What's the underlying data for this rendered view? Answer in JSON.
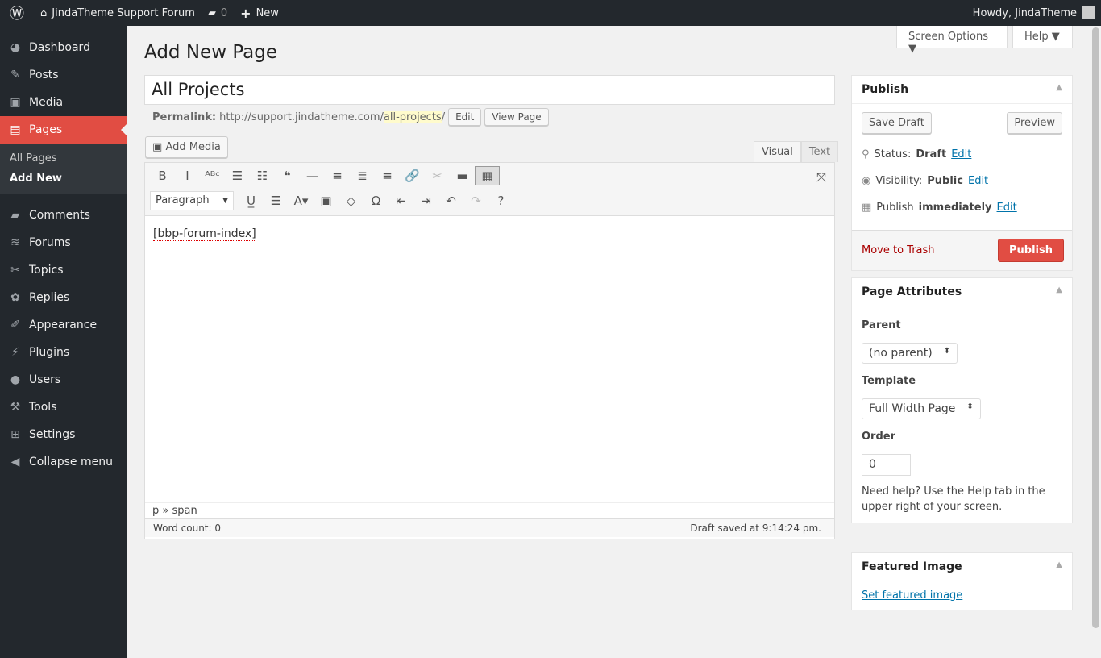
{
  "adminbar": {
    "site": "JindaTheme Support Forum",
    "comments": "0",
    "new": "New",
    "howdy": "Howdy, JindaTheme"
  },
  "menu": [
    {
      "label": "Dashboard",
      "icon": "dashboard-icon",
      "g": "◕"
    },
    {
      "label": "Posts",
      "icon": "pin-icon",
      "g": "✎"
    },
    {
      "label": "Media",
      "icon": "media-icon",
      "g": "▣"
    },
    {
      "label": "Pages",
      "icon": "pages-icon",
      "g": "▤"
    }
  ],
  "submenu": [
    "All Pages",
    "Add New"
  ],
  "menu2": [
    {
      "label": "Comments",
      "icon": "comment-icon",
      "g": "▰"
    },
    {
      "label": "Forums",
      "icon": "forums-icon",
      "g": "≋"
    },
    {
      "label": "Topics",
      "icon": "topics-icon",
      "g": "✂"
    },
    {
      "label": "Replies",
      "icon": "replies-icon",
      "g": "✿"
    },
    {
      "label": "Appearance",
      "icon": "brush-icon",
      "g": "✐"
    },
    {
      "label": "Plugins",
      "icon": "plugin-icon",
      "g": "⚡"
    },
    {
      "label": "Users",
      "icon": "user-icon",
      "g": "●"
    },
    {
      "label": "Tools",
      "icon": "wrench-icon",
      "g": "⚒"
    },
    {
      "label": "Settings",
      "icon": "settings-icon",
      "g": "⊞"
    },
    {
      "label": "Collapse menu",
      "icon": "collapse-icon",
      "g": "◀"
    }
  ],
  "screen_options": "Screen Options ▼",
  "help": "Help ▼",
  "page_title": "Add New Page",
  "post_title": "All Projects",
  "permalink": {
    "label": "Permalink:",
    "base": "http://support.jindatheme.com/",
    "slug": "all-projects",
    "trail": "/",
    "edit": "Edit",
    "view": "View Page"
  },
  "add_media": "Add Media",
  "tabs": {
    "visual": "Visual",
    "text": "Text"
  },
  "format": "Paragraph",
  "content": "[bbp-forum-index]",
  "path": "p » span",
  "word_count": "Word count: 0",
  "draft_saved": "Draft saved at 9:14:24 pm.",
  "publish": {
    "title": "Publish",
    "save_draft": "Save Draft",
    "preview": "Preview",
    "status_label": "Status:",
    "status": "Draft",
    "visibility_label": "Visibility:",
    "visibility": "Public",
    "publish_label": "Publish",
    "publish_when": "immediately",
    "edit": "Edit",
    "trash": "Move to Trash",
    "publish_btn": "Publish"
  },
  "attributes": {
    "title": "Page Attributes",
    "parent_label": "Parent",
    "parent": "(no parent)",
    "template_label": "Template",
    "template": "Full Width Page",
    "order_label": "Order",
    "order": "0",
    "help": "Need help? Use the Help tab in the upper right of your screen."
  },
  "featured": {
    "title": "Featured Image",
    "link": "Set featured image"
  }
}
